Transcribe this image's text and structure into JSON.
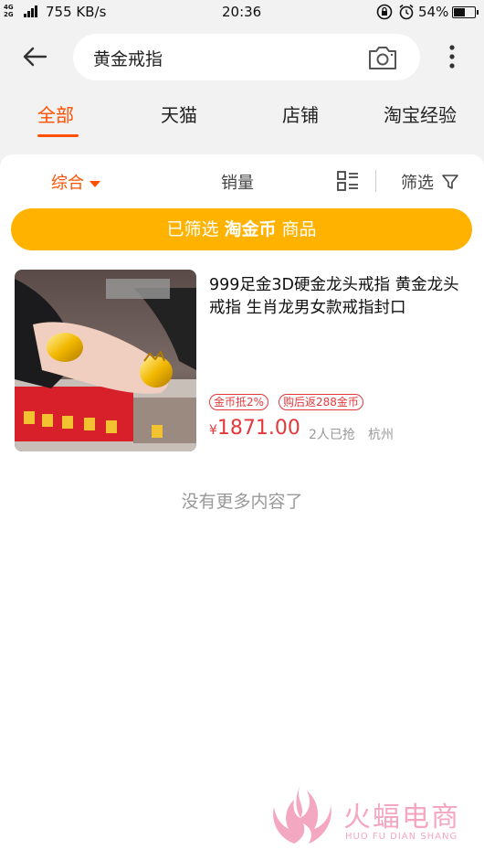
{
  "status_bar": {
    "network_top": "4G",
    "network_bottom": "2G",
    "speed": "755 KB/s",
    "time": "20:36",
    "battery": "54%"
  },
  "search": {
    "query": "黄金戒指",
    "placeholder": "黄金戒指"
  },
  "tabs": [
    {
      "label": "全部",
      "active": true
    },
    {
      "label": "天猫",
      "active": false
    },
    {
      "label": "店铺",
      "active": false
    },
    {
      "label": "淘宝经验",
      "active": false
    }
  ],
  "sort": {
    "comprehensive": "综合",
    "sales": "销量",
    "filter": "筛选"
  },
  "filter_banner": {
    "prefix": "已筛选",
    "highlight": "淘金币",
    "suffix": "商品"
  },
  "product": {
    "title": "999足金3D硬金龙头戒指 黄金龙头戒指 生肖龙男女款戒指封口",
    "tags": [
      "金币抵2%",
      "购后返288金币"
    ],
    "currency": "¥",
    "price": "1871.00",
    "sold": "2人已抢",
    "location": "杭州"
  },
  "end_text": "没有更多内容了",
  "watermark": {
    "title": "火蝠电商",
    "subtitle": "HUO FU DIAN SHANG"
  },
  "colors": {
    "accent": "#ff5000",
    "banner": "#ffb300",
    "price": "#e4393c",
    "watermark": "#f4a7c0"
  }
}
